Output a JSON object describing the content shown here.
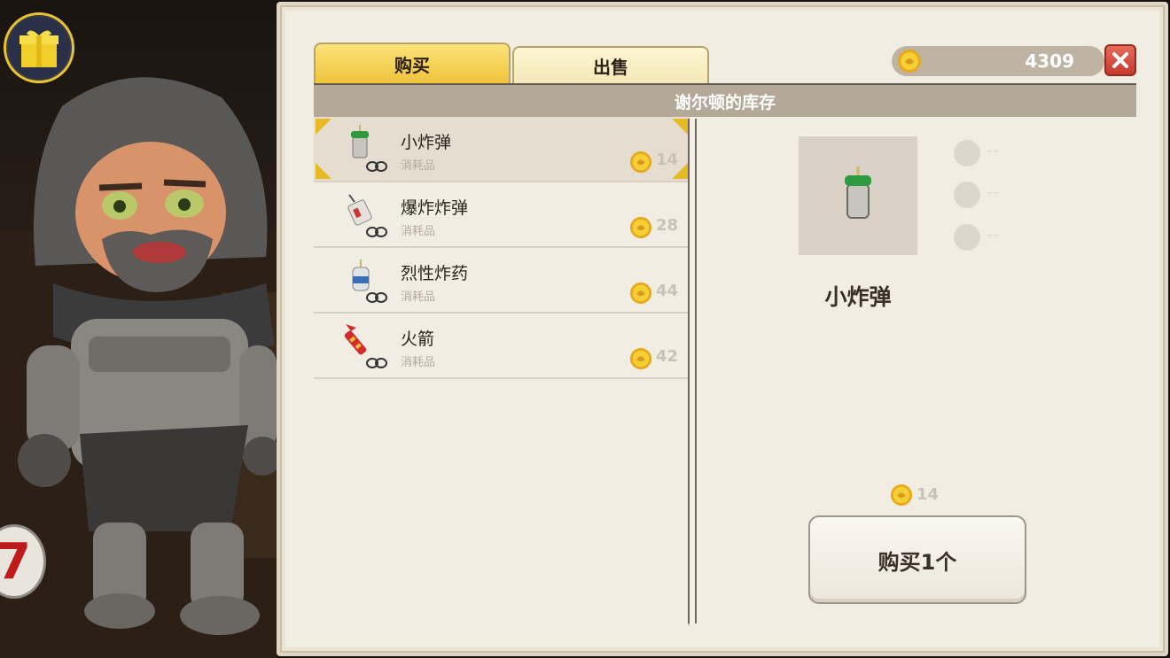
{
  "tabs": {
    "buy": "购买",
    "sell": "出售"
  },
  "currency": {
    "amount": "4309"
  },
  "inventory_header": "谢尔顿的库存",
  "items": [
    {
      "name": "小炸弹",
      "category": "消耗品",
      "price": "14",
      "icon": "small-bomb-icon"
    },
    {
      "name": "爆炸炸弹",
      "category": "消耗品",
      "price": "28",
      "icon": "explosive-bomb-icon"
    },
    {
      "name": "烈性炸药",
      "category": "消耗品",
      "price": "44",
      "icon": "dynamite-icon"
    },
    {
      "name": "火箭",
      "category": "消耗品",
      "price": "42",
      "icon": "rocket-icon"
    }
  ],
  "selected_index": 0,
  "detail": {
    "name": "小炸弹",
    "price": "14",
    "slots": [
      "--",
      "--",
      "--"
    ],
    "buy_label": "购买1个"
  },
  "scene": {
    "level_badge": "7"
  },
  "colors": {
    "accent_gold": "#f0c43b",
    "panel_bg": "#f2ede2",
    "close_red": "#c63b2e"
  }
}
